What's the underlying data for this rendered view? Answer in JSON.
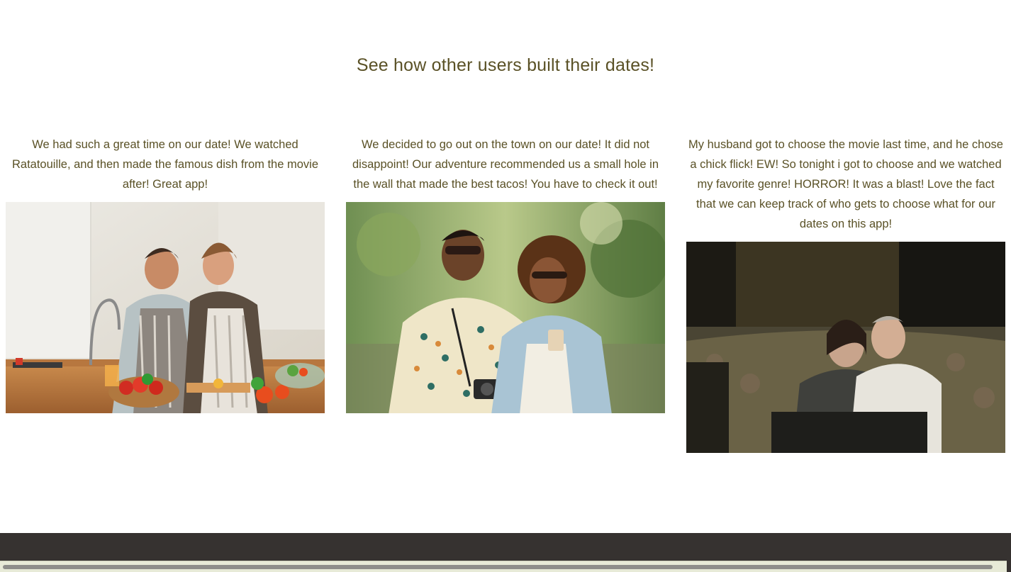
{
  "section": {
    "title": "See how other users built their dates!"
  },
  "testimonials": [
    {
      "text": "We had such a great time on our date! We watched Ratatouille, and then made the famous dish from the movie after! Great app!",
      "photo_icon": "couple-cooking-photo"
    },
    {
      "text": "We decided to go out on the town on our date! It did not disappoint! Our adventure recommended us a small hole in the wall that made the best tacos! You have to check it out!",
      "photo_icon": "couple-walking-photo"
    },
    {
      "text": "My husband got to choose the movie last time, and he chose a chick flick! EW! So tonight i got to choose and we watched my favorite genre! HORROR! It was a blast! Love the fact that we can keep track of who gets to choose what for our dates on this app!",
      "photo_icon": "couple-horror-movie-photo"
    }
  ],
  "colors": {
    "text": "#5a5126",
    "footer": "#363230",
    "background": "#ffffff"
  }
}
